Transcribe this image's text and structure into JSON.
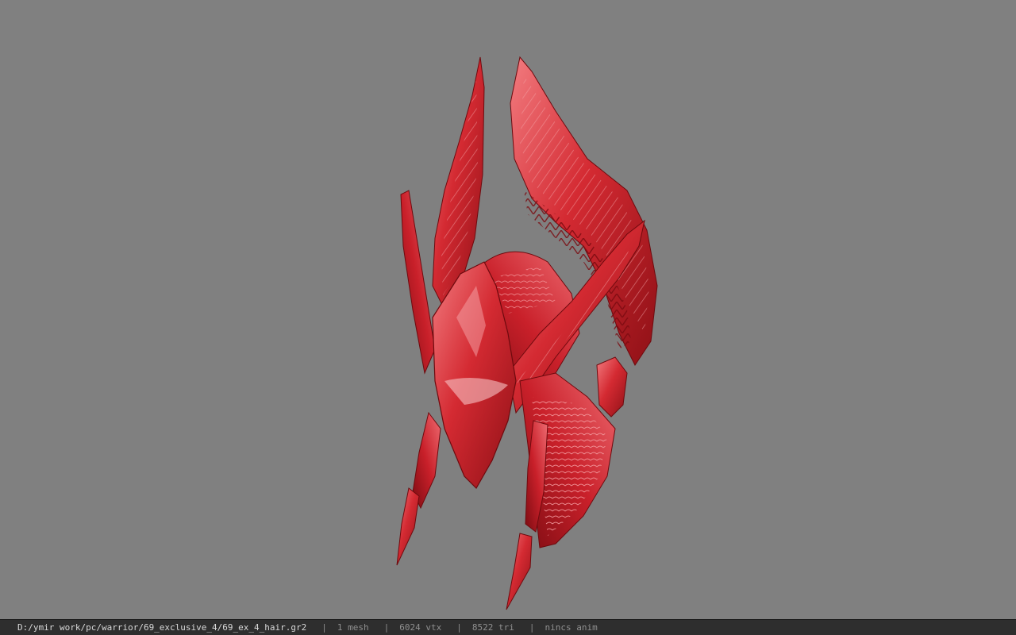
{
  "viewport": {
    "background": "#808080",
    "model_color": "#d42a32",
    "model_highlight": "#f07a7e",
    "model_shadow": "#8e1016"
  },
  "status_bar": {
    "file_path": "D:/ymir work/pc/warrior/69_exclusive_4/69_ex_4_hair.gr2",
    "separator": "|",
    "mesh_count": "1 mesh",
    "vertex_count": "6024 vtx",
    "triangle_count": "8522 tri",
    "anim_status": "nincs anim"
  }
}
